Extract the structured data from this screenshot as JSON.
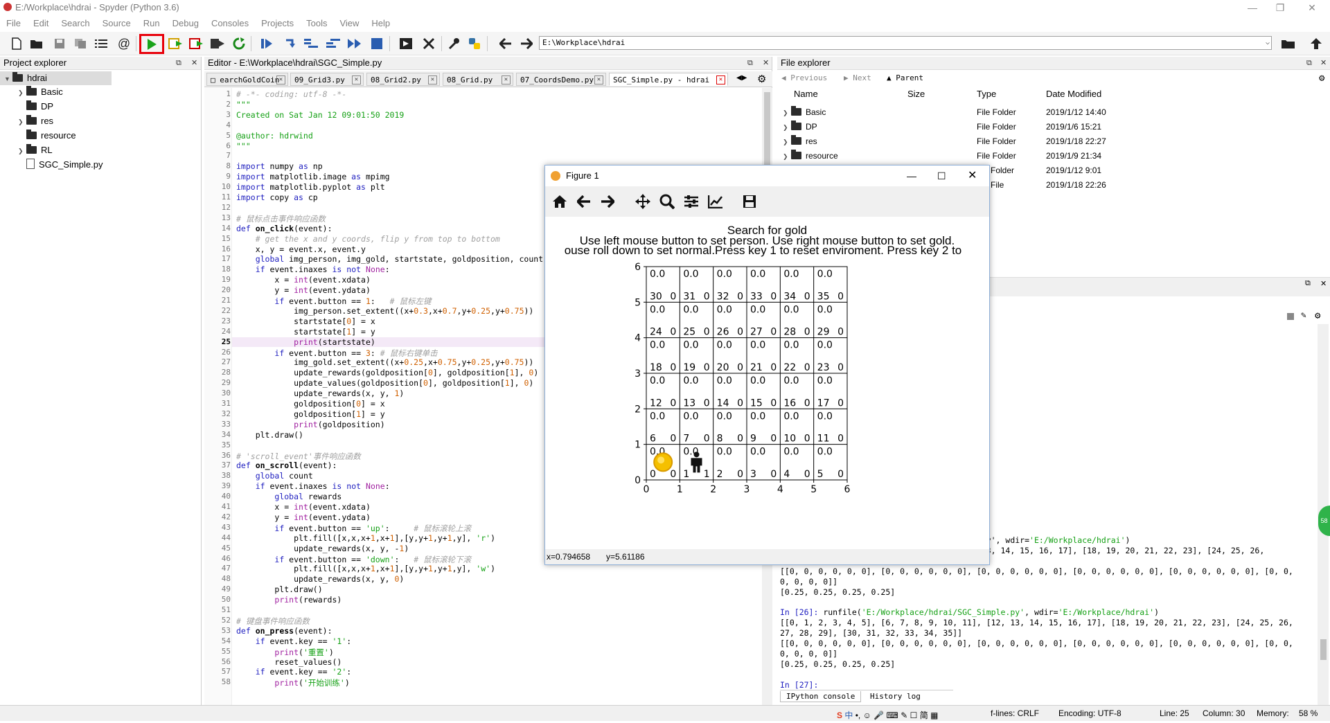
{
  "window": {
    "title": "E:/Workplace\\hdrai - Spyder (Python 3.6)",
    "controls": [
      "—",
      "❐",
      "✕"
    ]
  },
  "menu": [
    "File",
    "Edit",
    "Search",
    "Source",
    "Run",
    "Debug",
    "Consoles",
    "Projects",
    "Tools",
    "View",
    "Help"
  ],
  "toolbar": {
    "path": "E:\\Workplace\\hdrai",
    "highlighted": "run-button",
    "highlight_color": "#e8000a"
  },
  "project_explorer": {
    "header": "Project explorer",
    "root": "hdrai",
    "items": [
      {
        "label": "Basic",
        "type": "folder",
        "expandable": true
      },
      {
        "label": "DP",
        "type": "folder",
        "expandable": false
      },
      {
        "label": "res",
        "type": "folder",
        "expandable": true
      },
      {
        "label": "resource",
        "type": "folder",
        "expandable": false
      },
      {
        "label": "RL",
        "type": "folder",
        "expandable": true
      },
      {
        "label": "SGC_Simple.py",
        "type": "file",
        "expandable": false
      }
    ]
  },
  "editor": {
    "header": "Editor - E:\\Workplace\\hdrai\\SGC_Simple.py",
    "tabs": [
      "earchGoldCoin",
      "09_Grid3.py",
      "08_Grid2.py",
      "08_Grid.py",
      "07_CoordsDemo.py",
      "SGC_Simple.py - hdrai"
    ],
    "active_tab": 5,
    "current_line": 25,
    "lines": [
      {
        "n": "1",
        "html": "<span class='cm'># -*- coding: utf-8 -*-</span>"
      },
      {
        "n": "2",
        "html": "<span class='st'>\"\"\"</span>"
      },
      {
        "n": "3",
        "html": "<span class='st'>Created on Sat Jan 12 09:01:50 2019</span>"
      },
      {
        "n": "4",
        "html": ""
      },
      {
        "n": "5",
        "html": "<span class='st'>@author: hdrwind</span>"
      },
      {
        "n": "6",
        "html": "<span class='st'>\"\"\"</span>"
      },
      {
        "n": "7",
        "html": ""
      },
      {
        "n": "8",
        "html": "<span class='kw'>import</span> numpy <span class='kw'>as</span> np"
      },
      {
        "n": "9",
        "html": "<span class='kw'>import</span> matplotlib.image <span class='kw'>as</span> mpimg"
      },
      {
        "n": "10",
        "html": "<span class='kw'>import</span> matplotlib.pyplot <span class='kw'>as</span> plt"
      },
      {
        "n": "11",
        "html": "<span class='kw'>import</span> copy <span class='kw'>as</span> cp"
      },
      {
        "n": "12",
        "html": ""
      },
      {
        "n": "13",
        "html": "<span class='cm'># 鼠标点击事件响应函数</span>"
      },
      {
        "n": "14",
        "html": "<span class='kw'>def</span> <span class='fn'>on_click</span>(event):"
      },
      {
        "n": "15",
        "html": "    <span class='cm'># get the x and y coords, flip y from top to bottom</span>"
      },
      {
        "n": "16",
        "html": "    x, y = event.x, event.y"
      },
      {
        "n": "17",
        "html": "    <span class='kw'>global</span> img_person, img_gold, startstate, goldposition, count"
      },
      {
        "n": "18",
        "html": "    <span class='kw'>if</span> event.inaxes <span class='kw'>is</span> <span class='kw'>not</span> <span class='bi'>None</span>:"
      },
      {
        "n": "19",
        "html": "        x = <span class='bi'>int</span>(event.xdata)"
      },
      {
        "n": "20",
        "html": "        y = <span class='bi'>int</span>(event.ydata)"
      },
      {
        "n": "21",
        "html": "        <span class='kw'>if</span> event.button == <span class='nb'>1</span>:   <span class='cm'># 鼠标左键</span>"
      },
      {
        "n": "22",
        "html": "            img_person.set_extent((x+<span class='nb'>0.3</span>,x+<span class='nb'>0.7</span>,y+<span class='nb'>0.25</span>,y+<span class='nb'>0.75</span>))"
      },
      {
        "n": "23",
        "html": "            startstate[<span class='nb'>0</span>] = x"
      },
      {
        "n": "24",
        "html": "            startstate[<span class='nb'>1</span>] = y"
      },
      {
        "n": "25",
        "html": "            <span class='bi'>print</span>(startstate)"
      },
      {
        "n": "26",
        "html": "        <span class='kw'>if</span> event.button == <span class='nb'>3</span>: <span class='cm'># 鼠标右键单击</span>"
      },
      {
        "n": "27",
        "html": "            img_gold.set_extent((x+<span class='nb'>0.25</span>,x+<span class='nb'>0.75</span>,y+<span class='nb'>0.25</span>,y+<span class='nb'>0.75</span>))"
      },
      {
        "n": "28",
        "html": "            update_rewards(goldposition[<span class='nb'>0</span>], goldposition[<span class='nb'>1</span>], <span class='nb'>0</span>)"
      },
      {
        "n": "29",
        "html": "            update_values(goldposition[<span class='nb'>0</span>], goldposition[<span class='nb'>1</span>], <span class='nb'>0</span>)"
      },
      {
        "n": "30",
        "html": "            update_rewards(x, y, <span class='nb'>1</span>)"
      },
      {
        "n": "31",
        "html": "            goldposition[<span class='nb'>0</span>] = x"
      },
      {
        "n": "32",
        "html": "            goldposition[<span class='nb'>1</span>] = y"
      },
      {
        "n": "33",
        "html": "            <span class='bi'>print</span>(goldposition)"
      },
      {
        "n": "34",
        "html": "    plt.draw()"
      },
      {
        "n": "35",
        "html": ""
      },
      {
        "n": "36",
        "html": "<span class='cm'># 'scroll_event'事件响应函数</span>"
      },
      {
        "n": "37",
        "html": "<span class='kw'>def</span> <span class='fn'>on_scroll</span>(event):"
      },
      {
        "n": "38",
        "html": "    <span class='kw'>global</span> count"
      },
      {
        "n": "39",
        "html": "    <span class='kw'>if</span> event.inaxes <span class='kw'>is</span> <span class='kw'>not</span> <span class='bi'>None</span>:"
      },
      {
        "n": "40",
        "html": "        <span class='kw'>global</span> rewards"
      },
      {
        "n": "41",
        "html": "        x = <span class='bi'>int</span>(event.xdata)"
      },
      {
        "n": "42",
        "html": "        y = <span class='bi'>int</span>(event.ydata)"
      },
      {
        "n": "43",
        "html": "        <span class='kw'>if</span> event.button == <span class='st'>'up'</span>:     <span class='cm'># 鼠标滚轮上滚</span>"
      },
      {
        "n": "44",
        "html": "            plt.fill([x,x,x+<span class='nb'>1</span>,x+<span class='nb'>1</span>],[y,y+<span class='nb'>1</span>,y+<span class='nb'>1</span>,y], <span class='st'>'r'</span>)"
      },
      {
        "n": "45",
        "html": "            update_rewards(x, y, -<span class='nb'>1</span>)"
      },
      {
        "n": "46",
        "html": "        <span class='kw'>if</span> event.button == <span class='st'>'down'</span>:   <span class='cm'># 鼠标滚轮下滚</span>"
      },
      {
        "n": "47",
        "html": "            plt.fill([x,x,x+<span class='nb'>1</span>,x+<span class='nb'>1</span>],[y,y+<span class='nb'>1</span>,y+<span class='nb'>1</span>,y], <span class='st'>'w'</span>)"
      },
      {
        "n": "48",
        "html": "            update_rewards(x, y, <span class='nb'>0</span>)"
      },
      {
        "n": "49",
        "html": "        plt.draw()"
      },
      {
        "n": "50",
        "html": "        <span class='bi'>print</span>(rewards)"
      },
      {
        "n": "51",
        "html": ""
      },
      {
        "n": "52",
        "html": "<span class='cm'># 键盘事件响应函数</span>"
      },
      {
        "n": "53",
        "html": "<span class='kw'>def</span> <span class='fn'>on_press</span>(event):"
      },
      {
        "n": "54",
        "html": "    <span class='kw'>if</span> event.key == <span class='st'>'1'</span>:"
      },
      {
        "n": "55",
        "html": "        <span class='bi'>print</span>(<span class='st'>'重置'</span>)"
      },
      {
        "n": "56",
        "html": "        reset_values()"
      },
      {
        "n": "57",
        "html": "    <span class='kw'>if</span> event.key == <span class='st'>'2'</span>:"
      },
      {
        "n": "58",
        "html": "        <span class='bi'>print</span>(<span class='st'>'开始训练'</span>)"
      }
    ]
  },
  "file_explorer": {
    "header": "File explorer",
    "nav": {
      "previous": "Previous",
      "next": "Next",
      "parent": "Parent"
    },
    "columns": [
      "Name",
      "Size",
      "Type",
      "Date Modified"
    ],
    "rows": [
      {
        "name": "Basic",
        "type": "File Folder",
        "date": "2019/1/12 14:40"
      },
      {
        "name": "DP",
        "type": "File Folder",
        "date": "2019/1/6 15:21"
      },
      {
        "name": "res",
        "type": "File Folder",
        "date": "2019/1/18 22:27"
      },
      {
        "name": "resource",
        "type": "File Folder",
        "date": "2019/1/9 21:34"
      },
      {
        "name": "",
        "type": "Folder",
        "date": "2019/1/12 9:01"
      },
      {
        "name": "",
        "type": "File",
        "date": "2019/1/18 22:26"
      }
    ]
  },
  "console": {
    "tabs": [
      "IPython console",
      "History log"
    ],
    "lines": [
      {
        "html": "                                     mple.py', wdir=<span class='con-str'>'E:/Workplace/hdrai'</span>)"
      },
      {
        "html": "                                     [12, 13, 14, 15, 16, 17], [18, 19, 20, 21, 22, 23], [24, 25, 26,"
      },
      {
        "html": ""
      },
      {
        "html": "[[0, 0, 0, 0, 0, 0], [0, 0, 0, 0, 0, 0], [0, 0, 0, 0, 0, 0], [0, 0, 0, 0, 0, 0], [0, 0, 0, 0, 0, 0], [0, 0,"
      },
      {
        "html": "0, 0, 0, 0]]"
      },
      {
        "html": "[0.25, 0.25, 0.25, 0.25]"
      },
      {
        "html": ""
      },
      {
        "html": "<span class='con-prompt'>In [26]:</span> runfile(<span class='con-str'>'E:/Workplace/hdrai/SGC_Simple.py'</span>, wdir=<span class='con-str'>'E:/Workplace/hdrai'</span>)"
      },
      {
        "html": "[[0, 1, 2, 3, 4, 5], [6, 7, 8, 9, 10, 11], [12, 13, 14, 15, 16, 17], [18, 19, 20, 21, 22, 23], [24, 25, 26,"
      },
      {
        "html": "27, 28, 29], [30, 31, 32, 33, 34, 35]]"
      },
      {
        "html": "[[0, 0, 0, 0, 0, 0], [0, 0, 0, 0, 0, 0], [0, 0, 0, 0, 0, 0], [0, 0, 0, 0, 0, 0], [0, 0, 0, 0, 0, 0], [0, 0,"
      },
      {
        "html": "0, 0, 0, 0]]"
      },
      {
        "html": "[0.25, 0.25, 0.25, 0.25]"
      },
      {
        "html": ""
      },
      {
        "html": "<span class='con-prompt'>In [27]:</span>"
      }
    ]
  },
  "statusbar": {
    "eol": "f-lines: CRLF",
    "encoding": "Encoding: UTF-8",
    "line": "Line: 25",
    "column": "Column: 30",
    "memory": "Memory:",
    "memory_value": "58 %"
  },
  "figure": {
    "title": "Figure 1",
    "plot_title": "Search for gold",
    "line1": "Use left mouse button to set person. Use right mouse button to set gold.",
    "line2": "ouse roll down to set normal.Press key 1 to reset enviroment. Press key 2 to",
    "status_x": "x=0.794658",
    "status_y": "y=5.61186"
  },
  "chart_data": {
    "type": "heatmap",
    "title": "Search for gold",
    "xlim": [
      0,
      6
    ],
    "ylim": [
      0,
      6
    ],
    "x_ticks": [
      "0",
      "1",
      "2",
      "3",
      "4",
      "5",
      "6"
    ],
    "y_ticks": [
      "0",
      "1",
      "2",
      "3",
      "4",
      "5",
      "6"
    ],
    "grid": true,
    "cells": {
      "state_ids": [
        [
          0,
          1,
          2,
          3,
          4,
          5
        ],
        [
          6,
          7,
          8,
          9,
          10,
          11
        ],
        [
          12,
          13,
          14,
          15,
          16,
          17
        ],
        [
          18,
          19,
          20,
          21,
          22,
          23
        ],
        [
          24,
          25,
          26,
          27,
          28,
          29
        ],
        [
          30,
          31,
          32,
          33,
          34,
          35
        ]
      ],
      "values": [
        [
          "0.0",
          "0.0",
          "0.0",
          "0.0",
          "0.0",
          "0.0"
        ],
        [
          "0.0",
          "0.0",
          "0.0",
          "0.0",
          "0.0",
          "0.0"
        ],
        [
          "0.0",
          "0.0",
          "0.0",
          "0.0",
          "0.0",
          "0.0"
        ],
        [
          "0.0",
          "0.0",
          "0.0",
          "0.0",
          "0.0",
          "0.0"
        ],
        [
          "0.0",
          "0.0",
          "0.0",
          "0.0",
          "0.0",
          "0.0"
        ],
        [
          "0.0",
          "0.0",
          "0.0",
          "0.0",
          "0.0",
          "0.0"
        ]
      ],
      "rewards": [
        [
          0,
          1,
          0,
          0,
          0,
          0
        ],
        [
          0,
          0,
          0,
          0,
          0,
          0
        ],
        [
          0,
          0,
          0,
          0,
          0,
          0
        ],
        [
          0,
          0,
          0,
          0,
          0,
          0
        ],
        [
          0,
          0,
          0,
          0,
          0,
          0
        ],
        [
          0,
          0,
          0,
          0,
          0,
          0
        ]
      ]
    },
    "markers": [
      {
        "name": "gold-coin-icon",
        "x": 0.5,
        "y": 0.5
      },
      {
        "name": "person-icon",
        "x": 1.5,
        "y": 0.5
      }
    ]
  }
}
